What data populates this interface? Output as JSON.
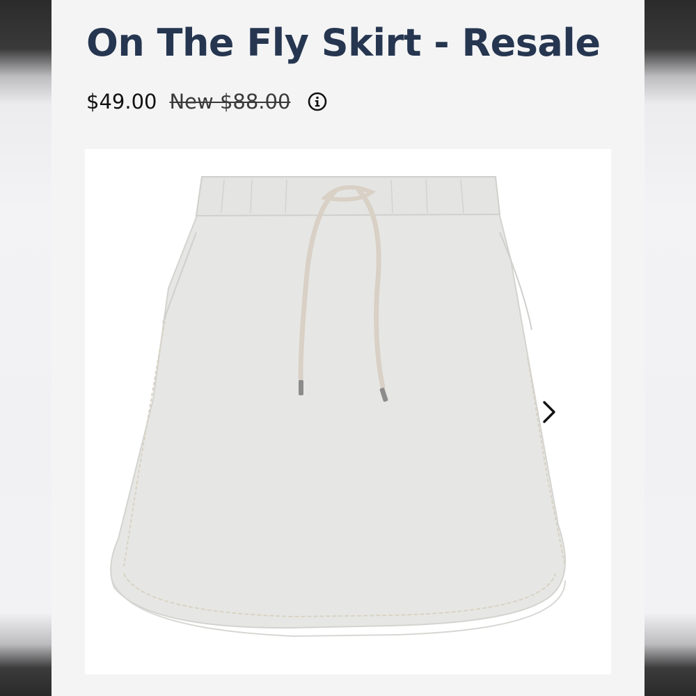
{
  "product": {
    "title": "On The Fly Skirt - Resale",
    "price": "$49.00",
    "original_price": "New $88.00",
    "info_icon": "info-circle-icon"
  },
  "gallery": {
    "next_icon": "chevron-right-icon"
  },
  "colors": {
    "title": "#263650",
    "panel_bg": "#f4f4f5",
    "skirt_fill": "#e6e7e4",
    "stitch": "#d9d2c4"
  }
}
